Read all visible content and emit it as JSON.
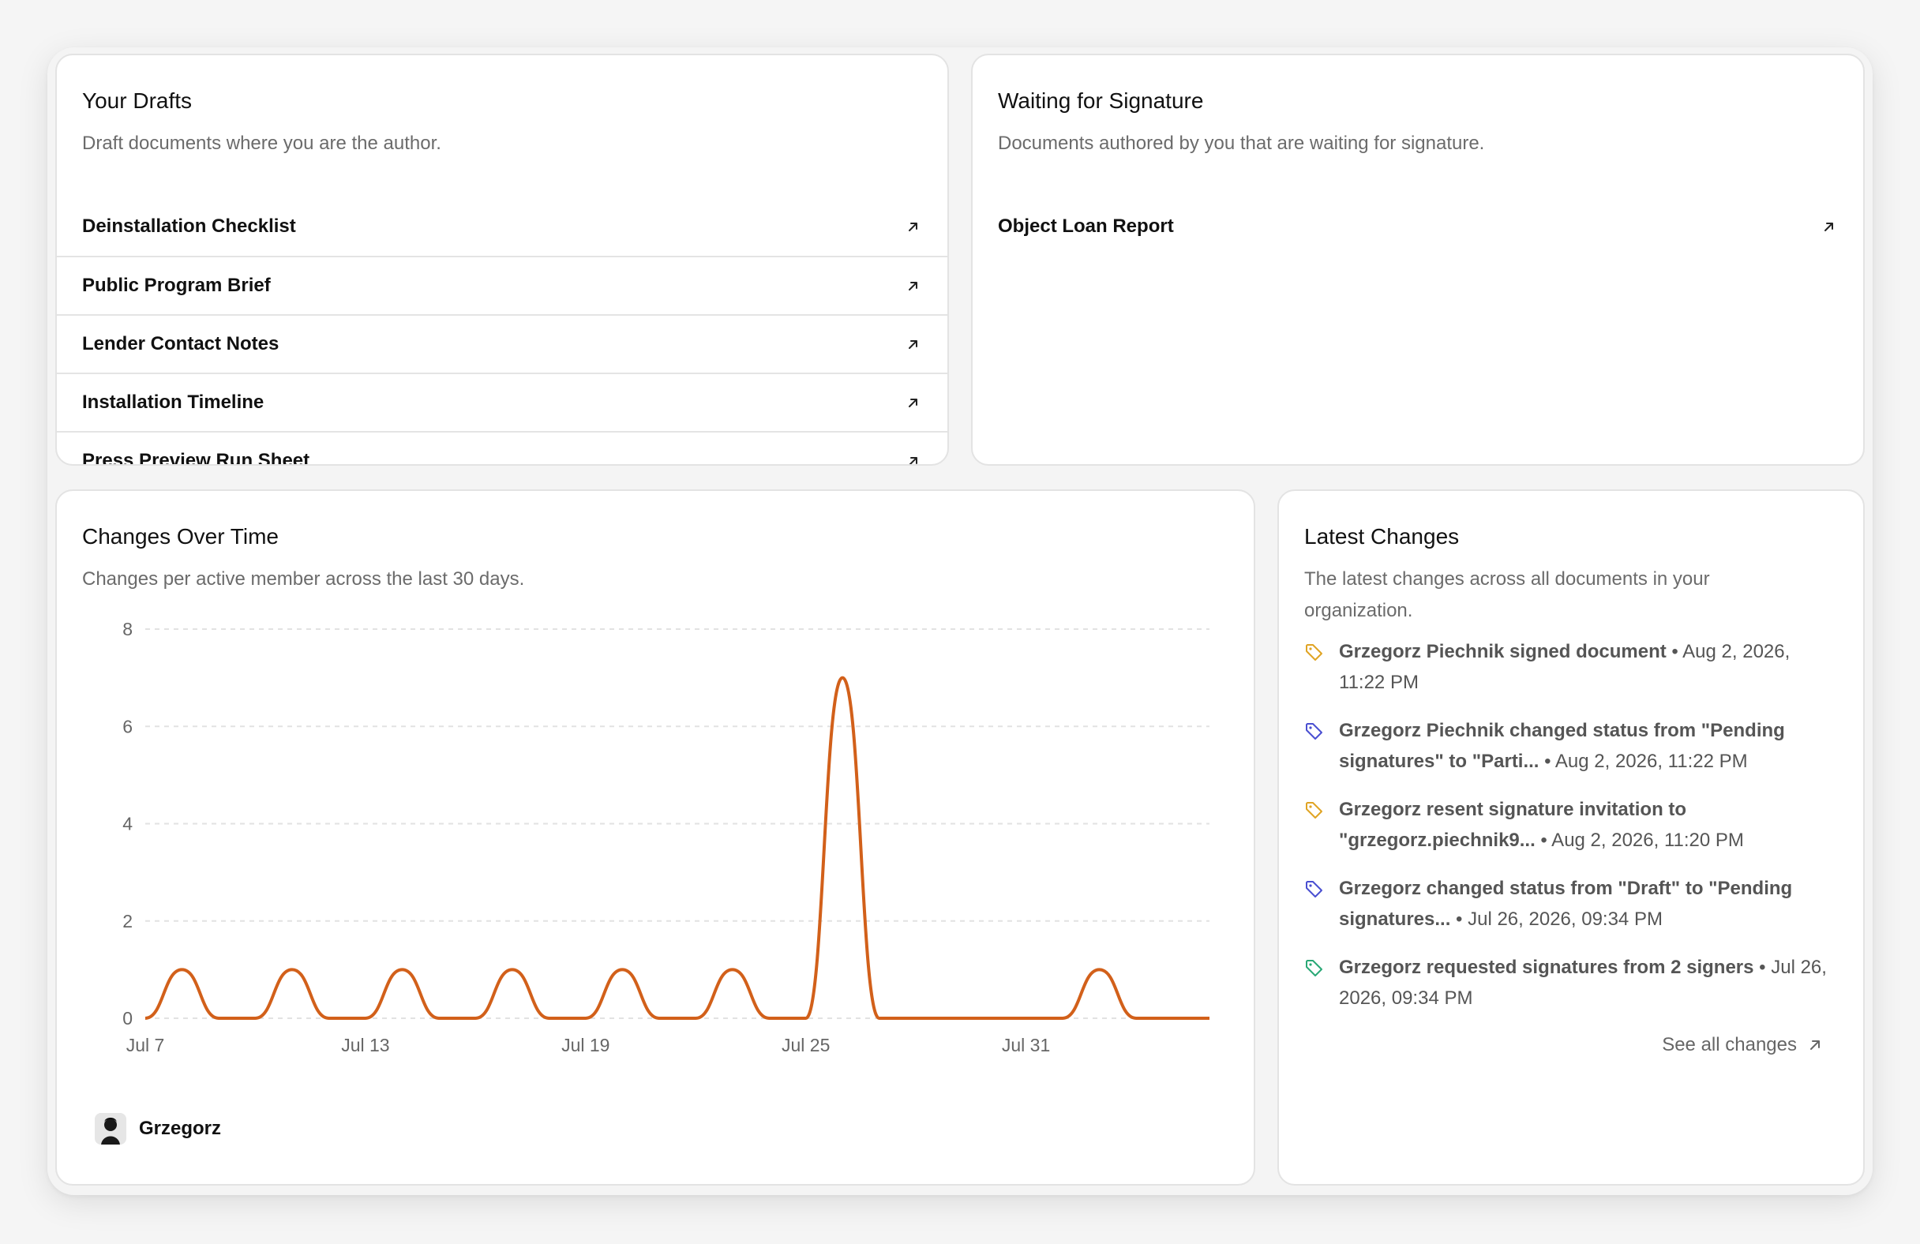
{
  "drafts": {
    "title": "Your Drafts",
    "subtitle": "Draft documents where you are the author.",
    "items": [
      {
        "label": "Deinstallation Checklist"
      },
      {
        "label": "Public Program Brief"
      },
      {
        "label": "Lender Contact Notes"
      },
      {
        "label": "Installation Timeline"
      },
      {
        "label": "Press Preview Run Sheet"
      }
    ]
  },
  "waiting": {
    "title": "Waiting for Signature",
    "subtitle": "Documents authored by you that are waiting for signature.",
    "items": [
      {
        "label": "Object Loan Report"
      }
    ]
  },
  "changes_over_time": {
    "title": "Changes Over Time",
    "subtitle": "Changes per active member across the last 30 days.",
    "legend": {
      "name": "Grzegorz"
    }
  },
  "chart_data": {
    "type": "line",
    "title": "Changes Over Time",
    "xlabel": "",
    "ylabel": "",
    "x_ticks": [
      "Jul 7",
      "Jul 13",
      "Jul 19",
      "Jul 25",
      "Jul 31"
    ],
    "y_ticks": [
      0,
      2,
      4,
      6,
      8
    ],
    "ylim": [
      0,
      8
    ],
    "grid": "horizontal dashed",
    "x": [
      "Jul 7",
      "Jul 8",
      "Jul 9",
      "Jul 10",
      "Jul 11",
      "Jul 12",
      "Jul 13",
      "Jul 14",
      "Jul 15",
      "Jul 16",
      "Jul 17",
      "Jul 18",
      "Jul 19",
      "Jul 20",
      "Jul 21",
      "Jul 22",
      "Jul 23",
      "Jul 24",
      "Jul 25",
      "Jul 26",
      "Jul 27",
      "Jul 28",
      "Jul 29",
      "Jul 30",
      "Jul 31",
      "Aug 1",
      "Aug 2",
      "Aug 3",
      "Aug 4",
      "Aug 5"
    ],
    "series": [
      {
        "name": "Grzegorz",
        "color": "#d2601a",
        "values": [
          0,
          1,
          0,
          0,
          1,
          0,
          0,
          1,
          0,
          0,
          1,
          0,
          0,
          1,
          0,
          0,
          1,
          0,
          0,
          7,
          0,
          0,
          0,
          0,
          0,
          0,
          1,
          0,
          0,
          0
        ]
      }
    ]
  },
  "latest": {
    "title": "Latest Changes",
    "subtitle_line1": "The latest changes across all documents in your",
    "subtitle_line2": "organization.",
    "items": [
      {
        "icon": "tag-icon",
        "color": "#e0a424",
        "text": "Grzegorz Piechnik signed document",
        "meta": " • Aug 2, 2026,",
        "line2": "11:22 PM"
      },
      {
        "icon": "tag-icon",
        "color": "#4a4fd1",
        "text": "Grzegorz Piechnik changed status from \"Pending",
        "line2b": "signatures\" to \"Parti...",
        "meta": " • Aug 2, 2026, 11:22 PM"
      },
      {
        "icon": "tag-icon",
        "color": "#e0a424",
        "text": "Grzegorz resent signature invitation to",
        "line2b": "\"grzegorz.piechnik9...",
        "meta": " • Aug 2, 2026, 11:20 PM"
      },
      {
        "icon": "tag-icon",
        "color": "#4a4fd1",
        "text": "Grzegorz changed status from \"Draft\" to \"Pending",
        "line2b": "signatures...",
        "meta": " • Jul 26, 2026, 09:34 PM"
      },
      {
        "icon": "tag-icon",
        "color": "#2aa876",
        "text": "Grzegorz requested signatures from 2 signers",
        "meta": " • Jul 26,",
        "line2": "2026, 09:34 PM"
      }
    ],
    "see_all": "See all changes"
  }
}
